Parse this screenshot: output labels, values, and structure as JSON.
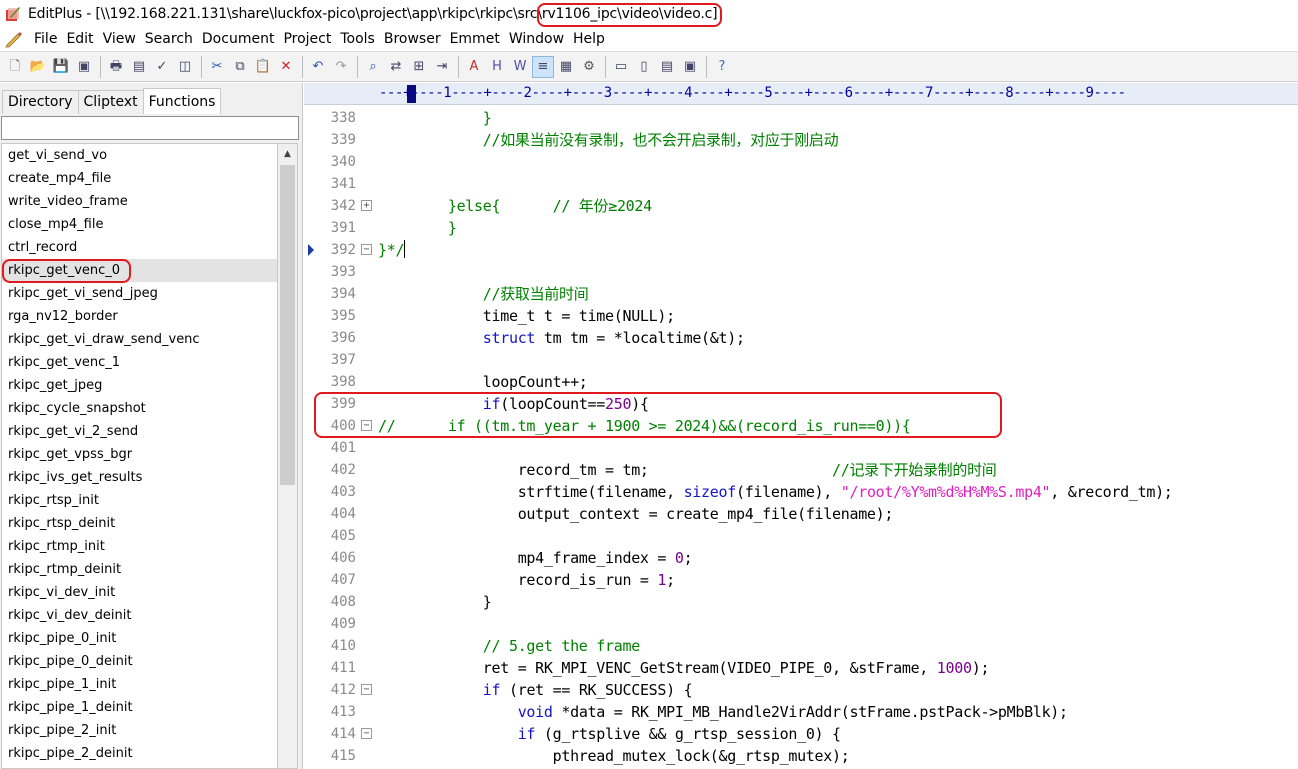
{
  "window": {
    "title_prefix": "EditPlus - [\\\\192.168.221.131\\share\\luckfox-pico\\project\\app\\rkipc\\rkipc\\src\\",
    "title_highlight": "rv1106_ipc\\video\\video.c]"
  },
  "menu": [
    "File",
    "Edit",
    "View",
    "Search",
    "Document",
    "Project",
    "Tools",
    "Browser",
    "Emmet",
    "Window",
    "Help"
  ],
  "toolbar": {
    "buttons": [
      "new-file-icon",
      "open-file-icon",
      "save-icon",
      "save-all-icon",
      "print-icon",
      "print-preview-icon",
      "spellcheck-icon",
      "browser-preview-icon",
      "cut-icon",
      "copy-icon",
      "paste-icon",
      "delete-icon",
      "undo-icon",
      "redo-icon",
      "find-icon",
      "replace-icon",
      "find-in-files-icon",
      "goto-line-icon",
      "font-icon",
      "hex-icon",
      "word-wrap-icon",
      "indent-icon",
      "ruler-icon",
      "preferences-icon",
      "window-1-icon",
      "window-2-icon",
      "window-3-icon",
      "window-4-icon",
      "help-icon"
    ]
  },
  "left_panel": {
    "tabs": [
      "Directory",
      "Cliptext",
      "Functions"
    ],
    "active_tab": "Functions",
    "filter_value": "",
    "selected_index": 5,
    "functions": [
      "get_vi_send_vo",
      "create_mp4_file",
      "write_video_frame",
      "close_mp4_file",
      "ctrl_record",
      "rkipc_get_venc_0",
      "rkipc_get_vi_send_jpeg",
      "rga_nv12_border",
      "rkipc_get_vi_draw_send_venc",
      "rkipc_get_venc_1",
      "rkipc_get_jpeg",
      "rkipc_cycle_snapshot",
      "rkipc_get_vi_2_send",
      "rkipc_get_vpss_bgr",
      "rkipc_ivs_get_results",
      "rkipc_rtsp_init",
      "rkipc_rtsp_deinit",
      "rkipc_rtmp_init",
      "rkipc_rtmp_deinit",
      "rkipc_vi_dev_init",
      "rkipc_vi_dev_deinit",
      "rkipc_pipe_0_init",
      "rkipc_pipe_0_deinit",
      "rkipc_pipe_1_init",
      "rkipc_pipe_1_deinit",
      "rkipc_pipe_2_init",
      "rkipc_pipe_2_deinit"
    ]
  },
  "editor": {
    "ruler": "---+----1----+----2----+----3----+----4----+----5----+----6----+----7----+----8----+----9----",
    "colors": {
      "keyword": "#1414cc",
      "comment": "#008000",
      "string": "#e020c0",
      "number": "#7a0090",
      "plain": "#000000"
    },
    "lines": [
      {
        "num": "338",
        "fold": "",
        "tokens": [
          {
            "t": "            }",
            "c": "comment"
          }
        ]
      },
      {
        "num": "339",
        "fold": "",
        "tokens": [
          {
            "t": "            //如果当前没有录制，也不会开启录制，对应于刚启动",
            "c": "comment"
          }
        ]
      },
      {
        "num": "340",
        "fold": "",
        "tokens": []
      },
      {
        "num": "341",
        "fold": "",
        "tokens": []
      },
      {
        "num": "342",
        "fold": "+",
        "tokens": [
          {
            "t": "        }else{      // 年份≥2024",
            "c": "comment"
          }
        ]
      },
      {
        "num": "391",
        "fold": "",
        "tokens": [
          {
            "t": "        }",
            "c": "comment"
          }
        ]
      },
      {
        "num": "392",
        "fold": "-",
        "marker": true,
        "cursor": true,
        "tokens": [
          {
            "t": "}*/",
            "c": "comment"
          }
        ]
      },
      {
        "num": "393",
        "fold": "",
        "tokens": []
      },
      {
        "num": "394",
        "fold": "",
        "tokens": [
          {
            "t": "            //获取当前时间",
            "c": "comment"
          }
        ]
      },
      {
        "num": "395",
        "fold": "",
        "tokens": [
          {
            "t": "            time_t t = time(NULL);",
            "c": "plain"
          }
        ]
      },
      {
        "num": "396",
        "fold": "",
        "tokens": [
          {
            "t": "            ",
            "c": "plain"
          },
          {
            "t": "struct",
            "c": "keyword"
          },
          {
            "t": " tm tm = *localtime(&t);",
            "c": "plain"
          }
        ]
      },
      {
        "num": "397",
        "fold": "",
        "tokens": []
      },
      {
        "num": "398",
        "fold": "",
        "tokens": [
          {
            "t": "            loopCount++;",
            "c": "plain"
          }
        ]
      },
      {
        "num": "399",
        "fold": "",
        "tokens": [
          {
            "t": "            ",
            "c": "plain"
          },
          {
            "t": "if",
            "c": "keyword"
          },
          {
            "t": "(loopCount==",
            "c": "plain"
          },
          {
            "t": "250",
            "c": "number"
          },
          {
            "t": "){",
            "c": "plain"
          }
        ]
      },
      {
        "num": "400",
        "fold": "-",
        "tokens": [
          {
            "t": "//      if ((tm.tm_year + 1900 >= 2024)&&(record_is_run==0)){",
            "c": "comment"
          }
        ]
      },
      {
        "num": "401",
        "fold": "",
        "tokens": []
      },
      {
        "num": "402",
        "fold": "",
        "tokens": [
          {
            "t": "                record_tm = tm;                     ",
            "c": "plain"
          },
          {
            "t": "//记录下开始录制的时间",
            "c": "comment"
          }
        ]
      },
      {
        "num": "403",
        "fold": "",
        "tokens": [
          {
            "t": "                strftime(filename, ",
            "c": "plain"
          },
          {
            "t": "sizeof",
            "c": "keyword"
          },
          {
            "t": "(filename), ",
            "c": "plain"
          },
          {
            "t": "\"/root/%Y%m%d%H%M%S.mp4\"",
            "c": "string"
          },
          {
            "t": ", &record_tm);",
            "c": "plain"
          }
        ]
      },
      {
        "num": "404",
        "fold": "",
        "tokens": [
          {
            "t": "                output_context = create_mp4_file(filename);",
            "c": "plain"
          }
        ]
      },
      {
        "num": "405",
        "fold": "",
        "tokens": []
      },
      {
        "num": "406",
        "fold": "",
        "tokens": [
          {
            "t": "                mp4_frame_index = ",
            "c": "plain"
          },
          {
            "t": "0",
            "c": "number"
          },
          {
            "t": ";",
            "c": "plain"
          }
        ]
      },
      {
        "num": "407",
        "fold": "",
        "tokens": [
          {
            "t": "                record_is_run = ",
            "c": "plain"
          },
          {
            "t": "1",
            "c": "number"
          },
          {
            "t": ";",
            "c": "plain"
          }
        ]
      },
      {
        "num": "408",
        "fold": "",
        "tokens": [
          {
            "t": "            }",
            "c": "plain"
          }
        ]
      },
      {
        "num": "409",
        "fold": "",
        "tokens": []
      },
      {
        "num": "410",
        "fold": "",
        "tokens": [
          {
            "t": "            // 5.get the frame",
            "c": "comment"
          }
        ]
      },
      {
        "num": "411",
        "fold": "",
        "tokens": [
          {
            "t": "            ret = RK_MPI_VENC_GetStream(VIDEO_PIPE_0, &stFrame, ",
            "c": "plain"
          },
          {
            "t": "1000",
            "c": "number"
          },
          {
            "t": ");",
            "c": "plain"
          }
        ]
      },
      {
        "num": "412",
        "fold": "-",
        "tokens": [
          {
            "t": "            ",
            "c": "plain"
          },
          {
            "t": "if",
            "c": "keyword"
          },
          {
            "t": " (ret == RK_SUCCESS) {",
            "c": "plain"
          }
        ]
      },
      {
        "num": "413",
        "fold": "",
        "tokens": [
          {
            "t": "                ",
            "c": "plain"
          },
          {
            "t": "void",
            "c": "keyword"
          },
          {
            "t": " *data = RK_MPI_MB_Handle2VirAddr(stFrame.pstPack->pMbBlk);",
            "c": "plain"
          }
        ]
      },
      {
        "num": "414",
        "fold": "-",
        "tokens": [
          {
            "t": "                ",
            "c": "plain"
          },
          {
            "t": "if",
            "c": "keyword"
          },
          {
            "t": " (g_rtsplive && g_rtsp_session_0) {",
            "c": "plain"
          }
        ]
      },
      {
        "num": "415",
        "fold": "",
        "tokens": [
          {
            "t": "                    pthread_mutex_lock(&g_rtsp_mutex);",
            "c": "plain"
          }
        ]
      }
    ]
  }
}
